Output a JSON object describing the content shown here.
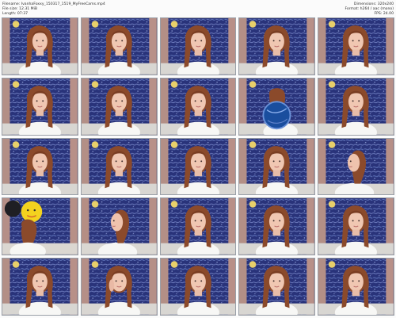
{
  "header": {
    "filename": "Filename: IvanhaFoxxy_150317_1519_MyFreeCams.mp4",
    "file_size": "File size: 12.31 MiB",
    "length": "Length: 07:37",
    "dimensions": "Dimensions: 320x240",
    "format": "Format: h264 / aac (mono)",
    "fps": "FPS: 24.00"
  },
  "thumbnails": [
    {
      "variant": "frontal"
    },
    {
      "variant": "frontal"
    },
    {
      "variant": "frontal"
    },
    {
      "variant": "frontal"
    },
    {
      "variant": "frontal"
    },
    {
      "variant": "frontal"
    },
    {
      "variant": "frontal"
    },
    {
      "variant": "frontal"
    },
    {
      "variant": "blue-ball"
    },
    {
      "variant": "frontal"
    },
    {
      "variant": "frontal"
    },
    {
      "variant": "frontal"
    },
    {
      "variant": "frontal"
    },
    {
      "variant": "frontal"
    },
    {
      "variant": "side"
    },
    {
      "variant": "yellow-balloon"
    },
    {
      "variant": "side"
    },
    {
      "variant": "frontal"
    },
    {
      "variant": "frontal"
    },
    {
      "variant": "frontal"
    },
    {
      "variant": "frontal"
    },
    {
      "variant": "hand"
    },
    {
      "variant": "frontal"
    },
    {
      "variant": "frontal"
    },
    {
      "variant": "frontal"
    }
  ]
}
